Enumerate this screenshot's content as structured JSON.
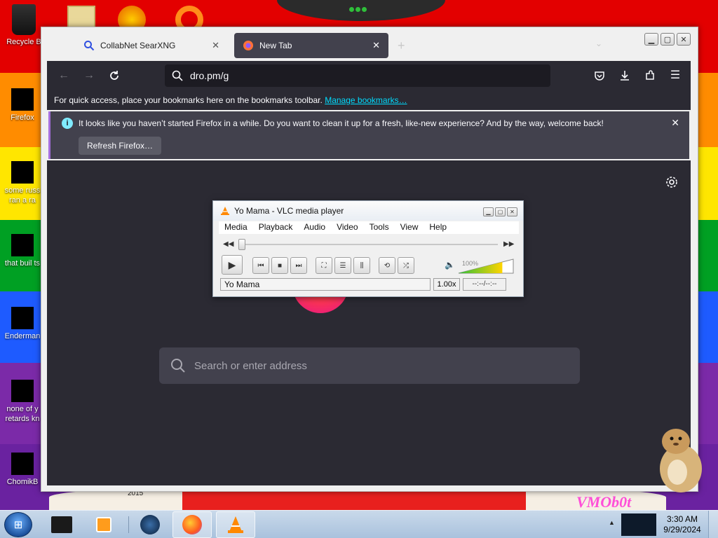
{
  "desktop": {
    "icons": [
      {
        "label": "Recycle B",
        "name": "recycle-bin"
      },
      {
        "label": "Firefox",
        "name": "firefox"
      },
      {
        "label": "some russ",
        "label2": "ran a ra",
        "name": "doc"
      },
      {
        "label": "that buil ts",
        "name": "folder"
      },
      {
        "label": "Enderman",
        "name": "enderman"
      },
      {
        "label": "none of y",
        "label2": "retards kn",
        "name": "none"
      },
      {
        "label": "ChomikB",
        "name": "chomik"
      }
    ],
    "wallpaper_text": "VMOb0t",
    "wallpaper_year": "2015",
    "colors": {
      "red": "#e30000",
      "orange": "#ff8c00",
      "yellow": "#ffe600",
      "green": "#00a023",
      "blue": "#1e5bff",
      "purple": "#7b2aa8"
    }
  },
  "firefox": {
    "tabs": [
      {
        "label": "CollabNet SearXNG",
        "icon": "search-icon",
        "active": false
      },
      {
        "label": "New Tab",
        "icon": "firefox-icon",
        "active": true
      }
    ],
    "url": "dro.pm/g",
    "bookmarks_message": "For quick access, place your bookmarks here on the bookmarks toolbar.",
    "bookmarks_link": "Manage bookmarks…",
    "notification": {
      "message": "It looks like you haven’t started Firefox in a while. Do you want to clean it up for a fresh, like-new experience? And by the way, welcome back!",
      "button": "Refresh Firefox…"
    },
    "search_placeholder": "Search or enter address",
    "accent": "#00ddff"
  },
  "vlc": {
    "title": "Yo Mama - VLC media player",
    "menu": [
      "Media",
      "Playback",
      "Audio",
      "Video",
      "Tools",
      "View",
      "Help"
    ],
    "status": "Yo Mama",
    "rate": "1.00x",
    "time": "--:--/--:--",
    "volume_label": "100%",
    "volume": 1.0
  },
  "taskbar": {
    "time": "3:30 AM",
    "date": "9/29/2024"
  }
}
